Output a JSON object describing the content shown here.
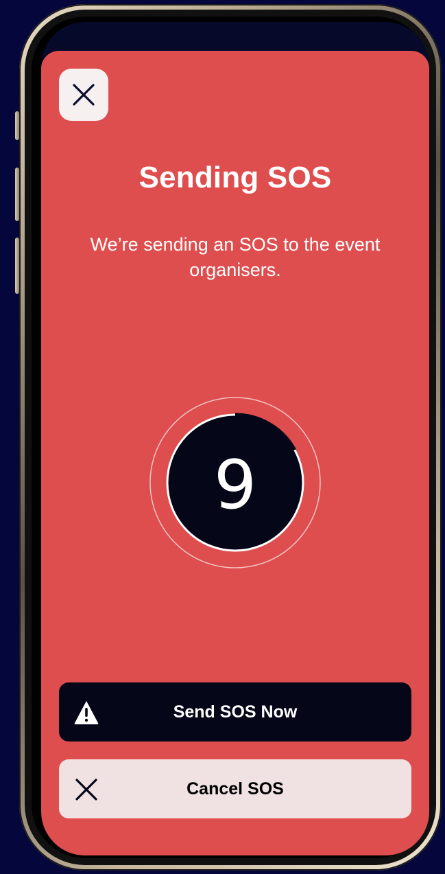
{
  "sheet": {
    "close_icon": "close-icon",
    "title": "Sending SOS",
    "subtitle": "We’re sending an SOS to the event organisers."
  },
  "countdown": {
    "value": "9",
    "progress_fraction": 0.17
  },
  "actions": {
    "send_now_label": "Send SOS Now",
    "send_now_icon": "warning-icon",
    "cancel_label": "Cancel SOS",
    "cancel_icon": "close-icon"
  },
  "colors": {
    "sheet_background": "#df4e4e",
    "dark": "#050719",
    "light_button": "#f0e1e3"
  }
}
